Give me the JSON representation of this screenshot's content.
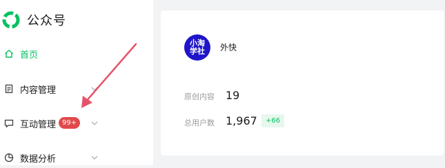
{
  "brand": {
    "name": "公众号"
  },
  "sidebar": {
    "items": [
      {
        "label": "首页",
        "active": true
      },
      {
        "label": "内容管理"
      },
      {
        "label": "互动管理",
        "badge": "99+"
      },
      {
        "label": "数据分析"
      }
    ]
  },
  "account": {
    "avatar_text": "小淘学社",
    "name": "外快"
  },
  "stats": [
    {
      "label": "原创内容",
      "value": "19"
    },
    {
      "label": "总用户数",
      "value": "1,967",
      "change": "+66"
    }
  ],
  "colors": {
    "accent": "#07c160",
    "badge": "#e04a4a",
    "arrow": "#e5536a",
    "avatar_bg": "#1f15c9"
  }
}
